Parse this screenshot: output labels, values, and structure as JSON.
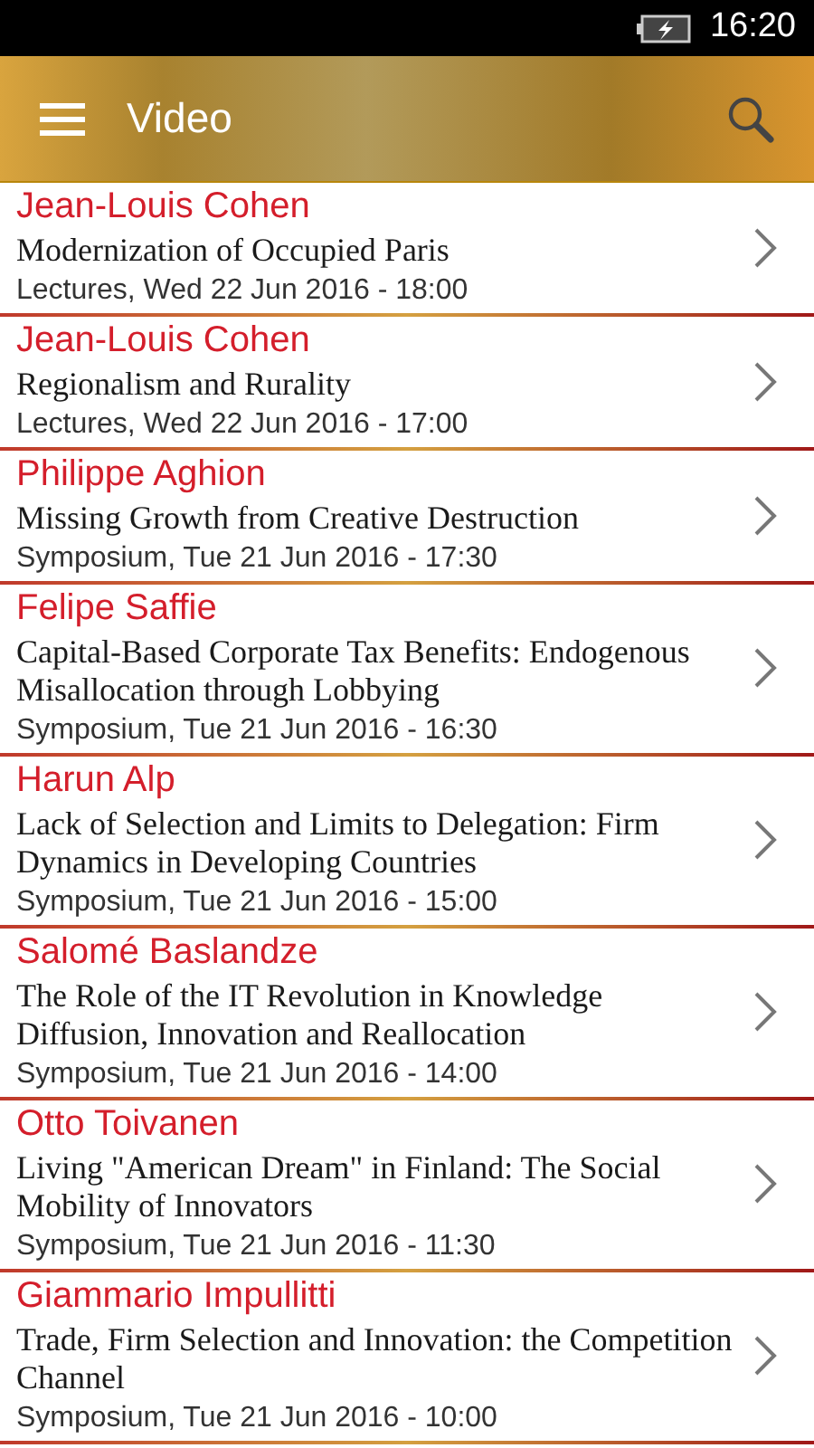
{
  "status_bar": {
    "time": "16:20"
  },
  "app_bar": {
    "title": "Video"
  },
  "items": [
    {
      "speaker": "Jean-Louis Cohen",
      "title": "Modernization of Occupied Paris",
      "meta": "Lectures, Wed 22 Jun 2016 - 18:00"
    },
    {
      "speaker": "Jean-Louis Cohen",
      "title": "Regionalism and Rurality",
      "meta": "Lectures, Wed 22 Jun 2016 - 17:00"
    },
    {
      "speaker": "Philippe Aghion",
      "title": "Missing Growth from Creative Destruction",
      "meta": "Symposium, Tue 21 Jun 2016 - 17:30"
    },
    {
      "speaker": "Felipe Saffie",
      "title": "Capital-Based Corporate Tax Benefits: Endogenous Misallocation through Lobbying",
      "meta": "Symposium, Tue 21 Jun 2016 - 16:30"
    },
    {
      "speaker": "Harun Alp",
      "title": "Lack of Selection and Limits to Delegation: Firm Dynamics in Developing Countries",
      "meta": "Symposium, Tue 21 Jun 2016 - 15:00"
    },
    {
      "speaker": "Salomé Baslandze",
      "title": "The Role of the IT Revolution in Knowledge Diffusion, Innovation and Reallocation",
      "meta": "Symposium, Tue 21 Jun 2016 - 14:00"
    },
    {
      "speaker": "Otto Toivanen",
      "title": "Living \"American Dream\" in Finland: The Social Mobility of Innovators",
      "meta": "Symposium, Tue 21 Jun 2016 - 11:30"
    },
    {
      "speaker": "Giammario Impullitti",
      "title": "Trade, Firm Selection and Innovation: the Competition Channel",
      "meta": "Symposium, Tue 21 Jun 2016 - 10:00"
    }
  ]
}
